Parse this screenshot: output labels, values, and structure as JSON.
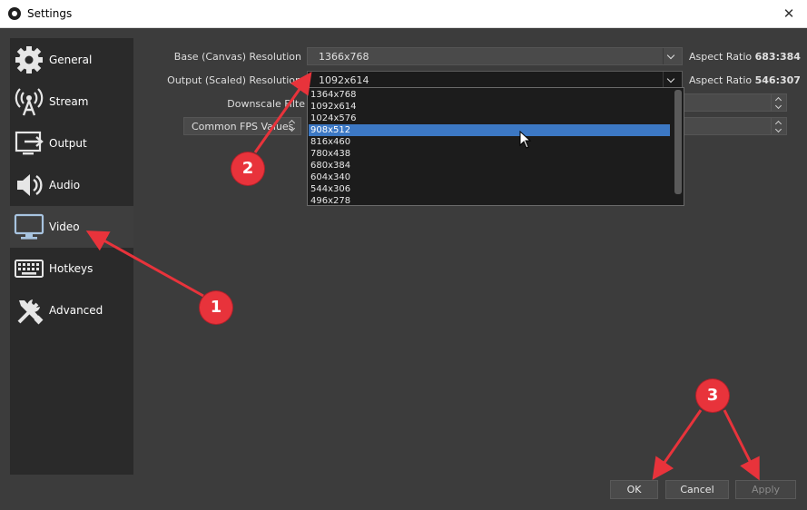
{
  "window": {
    "title": "Settings",
    "close_glyph": "✕"
  },
  "sidebar": {
    "items": [
      {
        "label": "General",
        "icon": "gear-icon"
      },
      {
        "label": "Stream",
        "icon": "broadcast-icon"
      },
      {
        "label": "Output",
        "icon": "output-icon"
      },
      {
        "label": "Audio",
        "icon": "speaker-icon"
      },
      {
        "label": "Video",
        "icon": "monitor-icon",
        "selected": true
      },
      {
        "label": "Hotkeys",
        "icon": "keyboard-icon"
      },
      {
        "label": "Advanced",
        "icon": "tools-icon"
      }
    ]
  },
  "video": {
    "base_label": "Base (Canvas) Resolution",
    "base_value": "1366x768",
    "base_aspect_label": "Aspect Ratio",
    "base_aspect_value": "683:384",
    "output_label": "Output (Scaled) Resolution",
    "output_value": "1092x614",
    "output_aspect_label": "Aspect Ratio",
    "output_aspect_value": "546:307",
    "downscale_label": "Downscale Filte",
    "fps_type": "Common FPS Values",
    "resolution_options": [
      "1364x768",
      "1092x614",
      "1024x576",
      "908x512",
      "816x460",
      "780x438",
      "680x384",
      "604x340",
      "544x306",
      "496x278"
    ],
    "highlighted_option": "908x512"
  },
  "buttons": {
    "ok": "OK",
    "cancel": "Cancel",
    "apply": "Apply"
  },
  "annotations": {
    "marker_1": "1",
    "marker_2": "2",
    "marker_3": "3"
  },
  "colors": {
    "marker": "#e8333b",
    "highlight": "#3c78c4",
    "panel": "#3c3c3c",
    "sidebar": "#2a2a2a"
  }
}
